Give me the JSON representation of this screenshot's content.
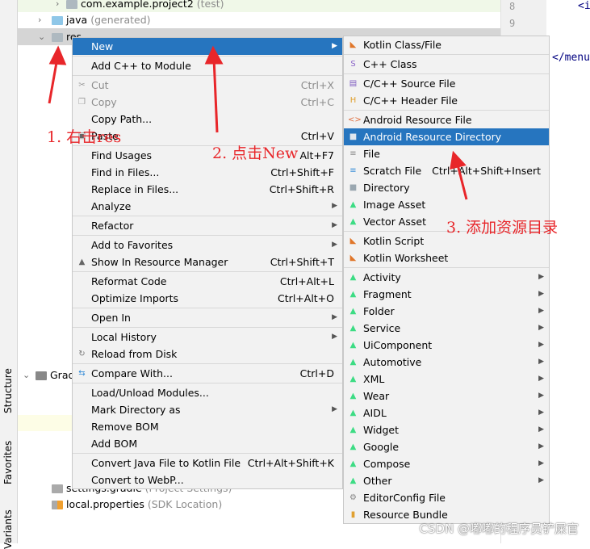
{
  "left_bar": {
    "tabs": [
      "Structure",
      "Favorites",
      "Variants"
    ]
  },
  "tree": {
    "rows": [
      {
        "name": "com.example.project2",
        "hint": "(test)"
      },
      {
        "name": "java",
        "hint": "(generated)"
      },
      {
        "name": "res",
        "hint": ""
      },
      {
        "name": "Gradle Scripts",
        "hint": ""
      },
      {
        "name": "settings.gradle",
        "hint": "(Project Settings)"
      },
      {
        "name": "local.properties",
        "hint": "(SDK Location)"
      }
    ]
  },
  "editor": {
    "line_numbers": [
      "8",
      "9"
    ],
    "code": [
      "<i",
      "</menu"
    ]
  },
  "context_menu": {
    "groups": [
      [
        {
          "label": "New",
          "arrow": true,
          "selected": true
        }
      ],
      [
        {
          "label": "Add C++ to Module"
        }
      ],
      [
        {
          "label": "Cut",
          "shortcut": "Ctrl+X",
          "disabled": true,
          "icon": "scissors-icon"
        },
        {
          "label": "Copy",
          "shortcut": "Ctrl+C",
          "disabled": true,
          "icon": "copy-icon"
        },
        {
          "label": "Copy Path..."
        },
        {
          "label": "Paste",
          "shortcut": "Ctrl+V",
          "icon": "clipboard-icon"
        }
      ],
      [
        {
          "label": "Find Usages",
          "shortcut": "Alt+F7"
        },
        {
          "label": "Find in Files...",
          "shortcut": "Ctrl+Shift+F"
        },
        {
          "label": "Replace in Files...",
          "shortcut": "Ctrl+Shift+R"
        },
        {
          "label": "Analyze",
          "arrow": true
        }
      ],
      [
        {
          "label": "Refactor",
          "arrow": true
        }
      ],
      [
        {
          "label": "Add to Favorites",
          "arrow": true
        },
        {
          "label": "Show In Resource Manager",
          "shortcut": "Ctrl+Shift+T",
          "icon": "resource-manager-icon"
        }
      ],
      [
        {
          "label": "Reformat Code",
          "shortcut": "Ctrl+Alt+L"
        },
        {
          "label": "Optimize Imports",
          "shortcut": "Ctrl+Alt+O"
        }
      ],
      [
        {
          "label": "Open In",
          "arrow": true
        }
      ],
      [
        {
          "label": "Local History",
          "arrow": true
        },
        {
          "label": "Reload from Disk",
          "icon": "reload-icon"
        }
      ],
      [
        {
          "label": "Compare With...",
          "shortcut": "Ctrl+D",
          "icon": "compare-icon"
        }
      ],
      [
        {
          "label": "Load/Unload Modules..."
        },
        {
          "label": "Mark Directory as",
          "arrow": true
        },
        {
          "label": "Remove BOM"
        },
        {
          "label": "Add BOM"
        }
      ],
      [
        {
          "label": "Convert Java File to Kotlin File",
          "shortcut": "Ctrl+Alt+Shift+K"
        },
        {
          "label": "Convert to WebP..."
        }
      ]
    ]
  },
  "submenu": {
    "groups": [
      [
        {
          "label": "Kotlin Class/File",
          "icon": "kotlin-file-icon"
        }
      ],
      [
        {
          "label": "C++ Class",
          "icon": "cpp-class-icon"
        }
      ],
      [
        {
          "label": "C/C++ Source File",
          "icon": "cpp-source-icon"
        },
        {
          "label": "C/C++ Header File",
          "icon": "cpp-header-icon"
        }
      ],
      [
        {
          "label": "Android Resource File",
          "icon": "android-resource-file-icon"
        },
        {
          "label": "Android Resource Directory",
          "icon": "folder-icon",
          "selected": true
        },
        {
          "label": "File",
          "icon": "file-icon"
        },
        {
          "label": "Scratch File",
          "shortcut": "Ctrl+Alt+Shift+Insert",
          "icon": "scratch-file-icon"
        },
        {
          "label": "Directory",
          "icon": "folder-icon"
        },
        {
          "label": "Image Asset",
          "icon": "android-icon"
        },
        {
          "label": "Vector Asset",
          "icon": "android-icon"
        }
      ],
      [
        {
          "label": "Kotlin Script",
          "icon": "kotlin-file-icon"
        },
        {
          "label": "Kotlin Worksheet",
          "icon": "kotlin-file-icon"
        }
      ],
      [
        {
          "label": "Activity",
          "arrow": true,
          "icon": "android-icon"
        },
        {
          "label": "Fragment",
          "arrow": true,
          "icon": "android-icon"
        },
        {
          "label": "Folder",
          "arrow": true,
          "icon": "android-icon"
        },
        {
          "label": "Service",
          "arrow": true,
          "icon": "android-icon"
        },
        {
          "label": "UiComponent",
          "arrow": true,
          "icon": "android-icon"
        },
        {
          "label": "Automotive",
          "arrow": true,
          "icon": "android-icon"
        },
        {
          "label": "XML",
          "arrow": true,
          "icon": "android-icon"
        },
        {
          "label": "Wear",
          "arrow": true,
          "icon": "android-icon"
        },
        {
          "label": "AIDL",
          "arrow": true,
          "icon": "android-icon"
        },
        {
          "label": "Widget",
          "arrow": true,
          "icon": "android-icon"
        },
        {
          "label": "Google",
          "arrow": true,
          "icon": "android-icon"
        },
        {
          "label": "Compose",
          "arrow": true,
          "icon": "android-icon"
        },
        {
          "label": "Other",
          "arrow": true,
          "icon": "android-icon"
        },
        {
          "label": "EditorConfig File",
          "icon": "gear-icon"
        },
        {
          "label": "Resource Bundle",
          "icon": "resource-bundle-icon"
        }
      ]
    ]
  },
  "annotations": {
    "step1": "1. 右击res",
    "step2": "2. 点击New",
    "step3": "3. 添加资源目录"
  },
  "watermark": "CSDN @嘟嘟的程序员铲屎官",
  "colors": {
    "selection": "#2675bf",
    "menu_bg": "#f2f2f2",
    "annotation": "#e8262a",
    "android_green": "#3ddc84"
  }
}
